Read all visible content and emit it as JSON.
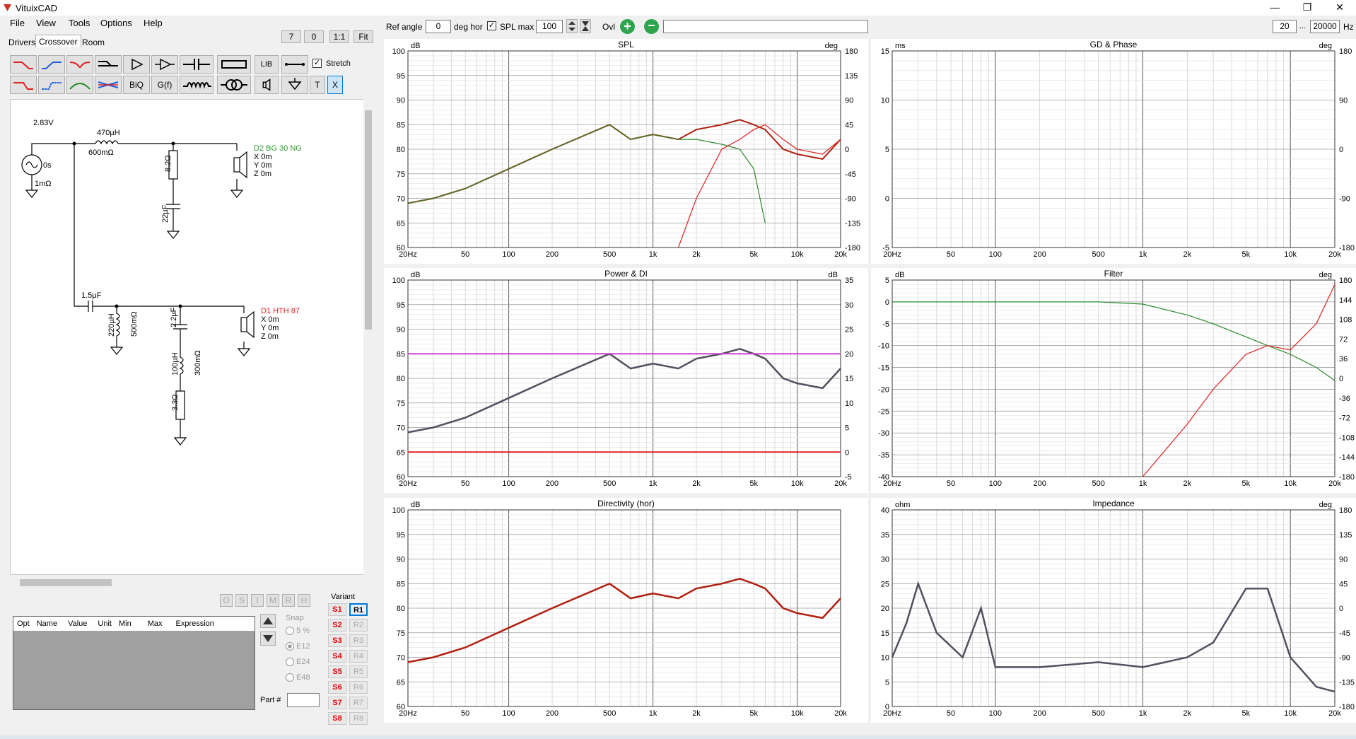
{
  "app": {
    "title": "VituixCAD"
  },
  "menu": [
    "File",
    "View",
    "Tools",
    "Options",
    "Help"
  ],
  "tabs": [
    "Drivers",
    "Crossover",
    "Room"
  ],
  "zoom_buttons": [
    "7",
    "0",
    "1:1",
    "Fit"
  ],
  "toolbar": {
    "lib": "LIB",
    "stretch": "Stretch",
    "biq": "BiQ",
    "gf": "G(f)",
    "t": "T",
    "x": "X"
  },
  "top": {
    "ref_angle_label": "Ref angle",
    "ref_angle_value": "0",
    "deg_hor": "deg hor",
    "spl_max": "SPL max",
    "spl_max_value": "100",
    "ovl": "Ovl",
    "freq_min": "20",
    "dots": "...",
    "freq_max": "20000",
    "hz": "Hz"
  },
  "schematic": {
    "source": {
      "v": "2.83V",
      "t": "0s",
      "r": "1mΩ"
    },
    "l1": {
      "l": "470µH",
      "r": "600mΩ"
    },
    "r1": "8.2Ω",
    "c1": "22µF",
    "d2": {
      "name": "D2 BG 30 NG",
      "x": "X 0m",
      "y": "Y 0m",
      "z": "Z 0m",
      "color": "#2a9a2a"
    },
    "c2": "1.5µF",
    "l2": {
      "l": "220µH",
      "r": "500mΩ"
    },
    "c3": "2.2µF",
    "l3": {
      "l": "100µH",
      "r": "300mΩ"
    },
    "r2": "3.3Ω",
    "d1": {
      "name": "D1 HTH 87",
      "x": "X 0m",
      "y": "Y 0m",
      "z": "Z 0m",
      "color": "#e02020"
    }
  },
  "opt_buttons": [
    "O",
    "S",
    "I",
    "M",
    "R",
    "H"
  ],
  "table_cols": [
    "Opt",
    "Name",
    "Value",
    "Unit",
    "Min",
    "Max",
    "Expression"
  ],
  "snap": {
    "label": "Snap",
    "opts": [
      "5 %",
      "E12",
      "E24",
      "E48"
    ],
    "selected": "E12"
  },
  "part_label": "Part #",
  "variant": {
    "label": "Variant",
    "s": [
      "S1",
      "S2",
      "S3",
      "S4",
      "S5",
      "S6",
      "S7",
      "S8"
    ],
    "r": [
      "R1",
      "R2",
      "R3",
      "R4",
      "R5",
      "R6",
      "R7",
      "R8"
    ]
  },
  "freq_ticks": [
    "20Hz",
    "50",
    "100",
    "200",
    "500",
    "1k",
    "2k",
    "5k",
    "10k",
    "20k"
  ],
  "charts": {
    "spl": {
      "title": "SPL",
      "lunit": "dB",
      "runit": "deg",
      "left": [
        "100",
        "95",
        "90",
        "85",
        "80",
        "75",
        "70",
        "65",
        "60"
      ],
      "right": [
        "180",
        "135",
        "90",
        "45",
        "0",
        "-45",
        "-90",
        "-135",
        "-180"
      ]
    },
    "gd": {
      "title": "GD & Phase",
      "lunit": "ms",
      "runit": "deg",
      "left": [
        "15",
        "10",
        "5",
        "0",
        "-5"
      ],
      "right": [
        "180",
        "90",
        "0",
        "-90",
        "-180"
      ]
    },
    "power": {
      "title": "Power & DI",
      "lunit": "dB",
      "runit": "dB",
      "left": [
        "100",
        "95",
        "90",
        "85",
        "80",
        "75",
        "70",
        "65",
        "60"
      ],
      "right": [
        "35",
        "30",
        "25",
        "20",
        "15",
        "10",
        "5",
        "0",
        "-5"
      ]
    },
    "filter": {
      "title": "Filter",
      "lunit": "dB",
      "runit": "deg",
      "left": [
        "5",
        "0",
        "-5",
        "-10",
        "-15",
        "-20",
        "-25",
        "-30",
        "-35",
        "-40"
      ],
      "right": [
        "180",
        "144",
        "108",
        "72",
        "36",
        "0",
        "-36",
        "-72",
        "-108",
        "-144",
        "-180"
      ]
    },
    "dir": {
      "title": "Directivity (hor)",
      "lunit": "dB",
      "runit": "",
      "left": [
        "100",
        "95",
        "90",
        "85",
        "80",
        "75",
        "70",
        "65",
        "60"
      ],
      "right": []
    },
    "imp": {
      "title": "Impedance",
      "lunit": "ohm",
      "runit": "deg",
      "left": [
        "40",
        "35",
        "30",
        "25",
        "20",
        "15",
        "10",
        "5",
        "0"
      ],
      "right": [
        "180",
        "135",
        "90",
        "45",
        "0",
        "-45",
        "-90",
        "-135",
        "-180"
      ]
    }
  },
  "colors": {
    "green": "#2a8a2a",
    "red": "#e02020",
    "dark": "#505060",
    "magenta": "#d040d0",
    "darkred": "#b02010"
  },
  "chart_data": [
    {
      "type": "line",
      "title": "SPL",
      "x": [
        20,
        30,
        50,
        100,
        200,
        500,
        700,
        1000,
        1500,
        2000,
        3000,
        4000,
        5000,
        6000,
        8000,
        10000,
        15000,
        20000
      ],
      "series": [
        {
          "values": [
            69,
            70,
            72,
            76,
            80,
            85,
            82,
            83,
            82,
            84,
            85,
            86,
            85,
            84,
            80,
            79,
            78,
            82
          ]
        },
        {
          "values": [
            69,
            70,
            72,
            76,
            80,
            85,
            82,
            83,
            82,
            82,
            81,
            80,
            76,
            65,
            null,
            null,
            null,
            null
          ]
        },
        {
          "values": [
            null,
            null,
            null,
            null,
            null,
            null,
            null,
            null,
            60,
            70,
            80,
            82,
            84,
            85,
            82,
            80,
            79,
            82
          ]
        }
      ],
      "ylim": [
        60,
        100
      ]
    },
    {
      "type": "line",
      "title": "Power & DI",
      "x": [
        20,
        30,
        50,
        100,
        200,
        500,
        700,
        1000,
        1500,
        2000,
        3000,
        4000,
        5000,
        6000,
        8000,
        10000,
        15000,
        20000
      ],
      "series": [
        {
          "values": [
            69,
            70,
            72,
            76,
            80,
            85,
            82,
            83,
            82,
            84,
            85,
            86,
            85,
            84,
            80,
            79,
            78,
            82
          ]
        },
        {
          "values": [
            85,
            85,
            85,
            85,
            85,
            85,
            85,
            85,
            85,
            85,
            85,
            85,
            85,
            85,
            85,
            85,
            85,
            85
          ]
        },
        {
          "values": [
            65,
            65,
            65,
            65,
            65,
            65,
            65,
            65,
            65,
            65,
            65,
            65,
            65,
            65,
            65,
            65,
            65,
            65
          ]
        }
      ],
      "ylim": [
        60,
        100
      ]
    },
    {
      "type": "line",
      "title": "Directivity (hor)",
      "x": [
        20,
        30,
        50,
        100,
        200,
        500,
        700,
        1000,
        1500,
        2000,
        3000,
        4000,
        5000,
        6000,
        8000,
        10000,
        15000,
        20000
      ],
      "series": [
        {
          "values": [
            69,
            70,
            72,
            76,
            80,
            85,
            82,
            83,
            82,
            84,
            85,
            86,
            85,
            84,
            80,
            79,
            78,
            82
          ]
        }
      ],
      "ylim": [
        60,
        100
      ]
    },
    {
      "type": "line",
      "title": "Filter",
      "x": [
        20,
        100,
        500,
        1000,
        2000,
        3000,
        5000,
        7000,
        10000,
        15000,
        20000
      ],
      "series": [
        {
          "values": [
            0,
            0,
            0,
            -0.5,
            -3,
            -5,
            -8,
            -10,
            -12,
            -15,
            -18
          ]
        },
        {
          "values": [
            null,
            null,
            null,
            -40,
            -28,
            -20,
            -12,
            -10,
            -11,
            -5,
            4
          ]
        }
      ],
      "ylim": [
        -40,
        5
      ]
    },
    {
      "type": "line",
      "title": "Impedance",
      "x": [
        20,
        25,
        30,
        40,
        60,
        80,
        100,
        200,
        500,
        1000,
        2000,
        3000,
        5000,
        7000,
        10000,
        15000,
        20000
      ],
      "series": [
        {
          "values": [
            10,
            17,
            25,
            15,
            10,
            20,
            8,
            8,
            9,
            8,
            10,
            13,
            24,
            24,
            10,
            4,
            3
          ]
        }
      ],
      "ylim": [
        0,
        40
      ]
    }
  ]
}
